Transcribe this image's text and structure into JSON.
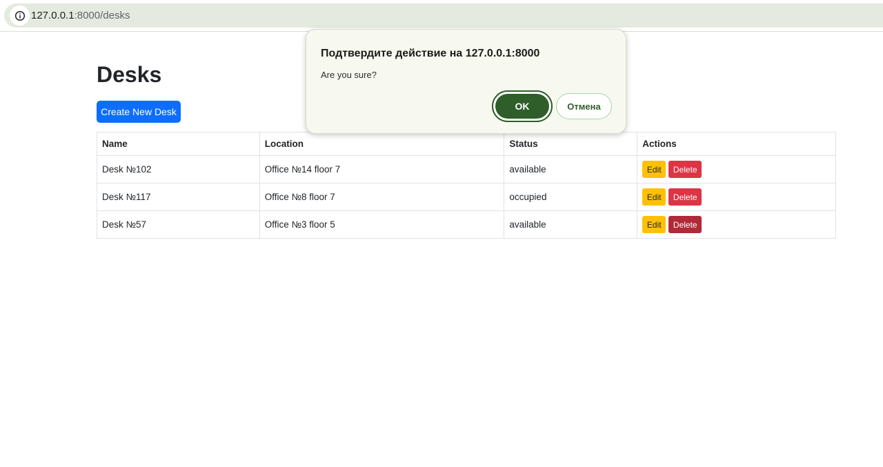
{
  "browser": {
    "url_host": "127.0.0.1",
    "url_path": ":8000/desks",
    "info_icon": "info-icon"
  },
  "page": {
    "title": "Desks",
    "create_button": "Create New Desk"
  },
  "table": {
    "headers": [
      "Name",
      "Location",
      "Status",
      "Actions"
    ],
    "rows": [
      {
        "name": "Desk №102",
        "location": "Office №14 floor 7",
        "status": "available",
        "edit": "Edit",
        "delete": "Delete"
      },
      {
        "name": "Desk №117",
        "location": "Office №8 floor 7",
        "status": "occupied",
        "edit": "Edit",
        "delete": "Delete"
      },
      {
        "name": "Desk №57",
        "location": "Office №3 floor 5",
        "status": "available",
        "edit": "Edit",
        "delete": "Delete"
      }
    ]
  },
  "dialog": {
    "title": "Подтвердите действие на 127.0.0.1:8000",
    "message": "Are you sure?",
    "ok_label": "OK",
    "cancel_label": "Отмена"
  },
  "colors": {
    "primary": "#0d6efd",
    "warning": "#ffc107",
    "danger": "#dc3545",
    "dialog_accent": "#2f5e2b"
  }
}
